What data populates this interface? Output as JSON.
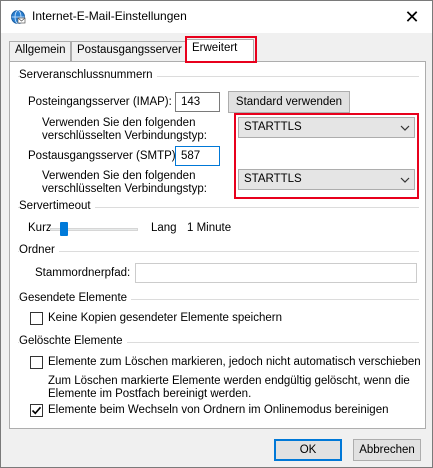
{
  "window": {
    "title": "Internet-E-Mail-Einstellungen",
    "icon": "globe-mail-icon",
    "close_symbol": "✕"
  },
  "tabs": [
    {
      "label": "Allgemein",
      "active": false
    },
    {
      "label": "Postausgangsserver",
      "active": false
    },
    {
      "label": "Erweitert",
      "active": true
    }
  ],
  "server_ports": {
    "heading": "Serveranschlussnummern",
    "incoming_label": "Posteingangsserver (IMAP):",
    "incoming_value": "143",
    "default_button": "Standard verwenden",
    "incoming_encryption_label": "Verwenden Sie den folgenden verschlüsselten Verbindungstyp:",
    "incoming_encryption_value": "STARTTLS",
    "outgoing_label": "Postausgangsserver (SMTP):",
    "outgoing_value": "587",
    "outgoing_encryption_label": "Verwenden Sie den folgenden verschlüsselten Verbindungstyp:",
    "outgoing_encryption_value": "STARTTLS"
  },
  "timeout": {
    "heading": "Servertimeout",
    "short_label": "Kurz",
    "long_label": "Lang",
    "value_text": "1 Minute",
    "level_fraction": 0.12
  },
  "folders": {
    "heading": "Ordner",
    "root_label": "Stammordnerpfad:",
    "root_value": ""
  },
  "sent_items": {
    "heading": "Gesendete Elemente",
    "no_copies_label": "Keine Kopien gesendeter Elemente speichern",
    "no_copies_checked": false
  },
  "deleted_items": {
    "heading": "Gelöschte Elemente",
    "mark_label": "Elemente zum Löschen markieren, jedoch nicht automatisch verschieben",
    "mark_checked": false,
    "note_text": "Zum Löschen markierte Elemente werden endgültig gelöscht, wenn die Elemente im Postfach bereinigt werden.",
    "purge_label": "Elemente beim Wechseln von Ordnern im Onlinemodus bereinigen",
    "purge_checked": true
  },
  "footer": {
    "ok_label": "OK",
    "cancel_label": "Abbrechen"
  },
  "colors": {
    "highlight": "#e8001c",
    "accent": "#0078d7"
  }
}
